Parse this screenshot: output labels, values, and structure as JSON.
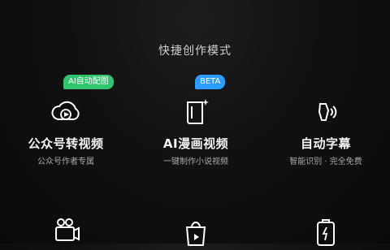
{
  "section_title": "快捷创作模式",
  "modes": [
    {
      "label": "公众号转视频",
      "sub": "公众号作者专属",
      "badge": "AI自动配图",
      "icon": "cloud-play-icon"
    },
    {
      "label": "AI漫画视频",
      "sub": "一键制作小说视频",
      "badge": "BETA",
      "icon": "book-sparkle-icon"
    },
    {
      "label": "自动字幕",
      "sub": "智能识别 · 完全免费",
      "icon": "voice-speaker-icon"
    },
    {
      "icon": "film-camera-icon"
    },
    {
      "icon": "shopping-bag-play-icon"
    },
    {
      "icon": "battery-card-icon"
    }
  ],
  "colors": {
    "badge_green": "#2fc46e",
    "badge_blue": "#2d9cff",
    "background": "#111112"
  }
}
